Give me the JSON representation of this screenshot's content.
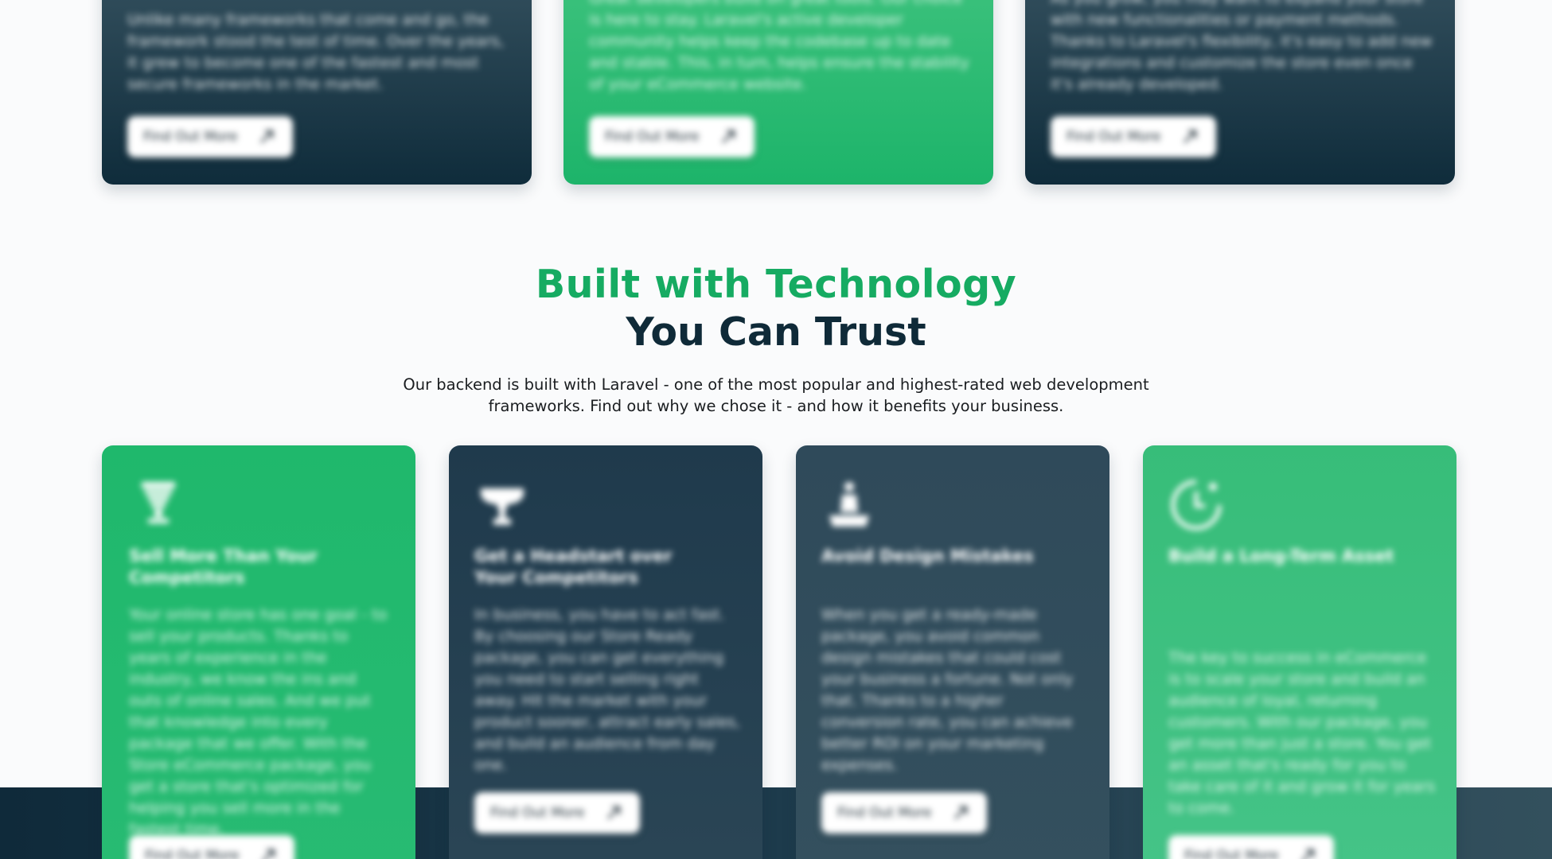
{
  "top_cards": [
    {
      "text": "Unlike many frameworks that come and go, the framework stood the test of time. Over the years, it grew to become one of the fastest and most secure frameworks in the market.",
      "button": "Find Out More"
    },
    {
      "text": "Great developers build on great tools. Our choice is here to stay. Laravel's active developer community helps keep the codebase up to date and stable. This, in turn, helps ensure the stability of your eCommerce website.",
      "button": "Find Out More"
    },
    {
      "text": "As you grow, you may want to expand your store with new functionalities or payment methods. Thanks to Laravel's flexibility, it's easy to add new integrations and customize the store even once it's already developed.",
      "button": "Find Out More"
    }
  ],
  "section": {
    "title_line1": "Built with Technology",
    "title_line2": "You Can Trust",
    "intro_line1": "Our backend is built with Laravel - one of the most popular and highest-rated web development",
    "intro_line2": "frameworks. Find out why we chose it - and how it benefits your business."
  },
  "benefit_cards": [
    {
      "icon": "trophy-icon",
      "title": "Sell More Than Your Competitors",
      "text": "Your online store has one goal - to sell your products. Thanks to years of experience in the industry, we know the ins and outs of online sales. And we put that knowledge into every package that we offer. With the Store eCommerce package, you get a store that's optimized for helping you sell more in the fastest time.",
      "button": "Find Out More"
    },
    {
      "icon": "trophy-cup-icon",
      "title": "Get a Headstart over Your Competitors",
      "text": "In business, you have to act fast. By choosing our Store Ready package, you can get everything you need to start selling right away. Hit the market with your product sooner, attract early sales, and build an audience from day one.",
      "button": "Find Out More"
    },
    {
      "icon": "person-podium-icon",
      "title": "Avoid Design Mistakes",
      "text": "When you get a ready-made package, you avoid common design mistakes that could cost your business a fortune. Not only that. Thanks to a higher conversion rate, you can achieve better ROI on your marketing expenses.",
      "button": "Find Out More"
    },
    {
      "icon": "clock-dollar-icon",
      "title": "Build a Long-Term Asset",
      "text": "The key to success in eCommerce is to scale your store and build an audience of loyal, returning customers. With our package, you get more than just a store. You get an asset that's ready for you to take care of it and grow it for years to come.",
      "button": "Find Out More"
    }
  ],
  "colors": {
    "green": "#16ab62",
    "navy": "#0f2a38",
    "slate": "#34505e"
  }
}
